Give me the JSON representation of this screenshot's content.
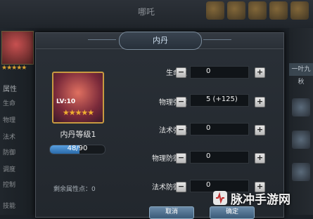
{
  "background": {
    "title": "哪吒",
    "left_attr_title": "属性",
    "left_attrs": [
      "生命",
      "物理",
      "法术",
      "防御",
      "调度",
      "控制"
    ],
    "skill_label": "技能",
    "right_tab": "一叶九秋"
  },
  "dialog": {
    "title": "内丹"
  },
  "hero": {
    "level_badge": "LV:10",
    "stars": "★★★★★",
    "inner_dan_level": "内丹等级1",
    "xp_text": "48/90",
    "xp_fraction": 0.533,
    "remaining_points_label": "剩余属性点：0"
  },
  "stats": [
    {
      "label": "生命值",
      "value": "0"
    },
    {
      "label": "物理强度",
      "value": "5 (+125)"
    },
    {
      "label": "法术强度",
      "value": "0"
    },
    {
      "label": "物理防御力",
      "value": "0"
    },
    {
      "label": "法术防御力",
      "value": "0"
    }
  ],
  "buttons": {
    "minus": "−",
    "plus": "+",
    "cancel": "取消",
    "confirm": "确定"
  },
  "watermark": {
    "text": "脉冲手游网"
  },
  "colors": {
    "accent_gold": "#c89a40",
    "xp_blue": "#3a7ac0",
    "button_blue": "#4a6a88"
  }
}
